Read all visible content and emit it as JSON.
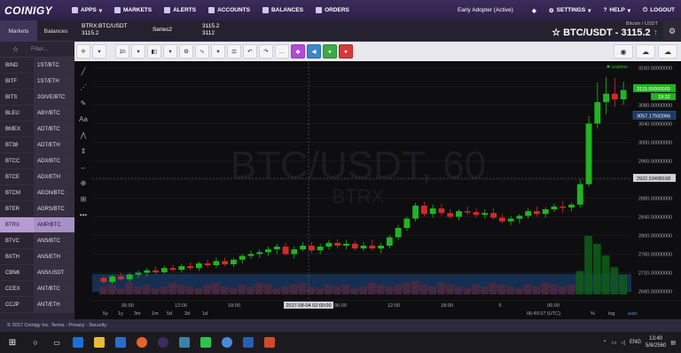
{
  "nav": {
    "logo": "COINIGY",
    "items": [
      "APPS",
      "MARKETS",
      "ALERTS",
      "ACCOUNTS",
      "BALANCES",
      "ORDERS"
    ],
    "status": "Early Adopter (Active)",
    "right_items": [
      "SETTINGS",
      "HELP",
      "LOGOUT"
    ]
  },
  "subheader": {
    "tabs": [
      "Markets",
      "Balances"
    ],
    "market1_name": "BTRX:BTC/USDT",
    "market1_price": "3115.2",
    "market2_name": "Series2",
    "market2_p1": "3115.2",
    "market2_p2": "3112",
    "pair_sub": "Bitcoin / USDT",
    "pair_title": "BTC/USDT - 3115.2"
  },
  "sidebar": {
    "filter_placeholder": "Filter...",
    "rows": [
      {
        "exch": "BIND",
        "pair": "1ST/BTC"
      },
      {
        "exch": "BITF",
        "pair": "1ST/ETH"
      },
      {
        "exch": "BITS",
        "pair": "2GIVE/BTC"
      },
      {
        "exch": "BLEU",
        "pair": "ABY/BTC"
      },
      {
        "exch": "BMEX",
        "pair": "ADT/BTC"
      },
      {
        "exch": "BT38",
        "pair": "ADT/ETH"
      },
      {
        "exch": "BTCC",
        "pair": "ADX/BTC"
      },
      {
        "exch": "BTCE",
        "pair": "ADX/ETH"
      },
      {
        "exch": "BTCM",
        "pair": "AEON/BTC"
      },
      {
        "exch": "BTER",
        "pair": "AGRS/BTC"
      },
      {
        "exch": "BTRX",
        "pair": "AMP/BTC"
      },
      {
        "exch": "BTVC",
        "pair": "ANS/BTC"
      },
      {
        "exch": "BXTH",
        "pair": "ANS/ETH"
      },
      {
        "exch": "CBNK",
        "pair": "ANS/USDT"
      },
      {
        "exch": "CCEX",
        "pair": "ANT/BTC"
      },
      {
        "exch": "CCJP",
        "pair": "ANT/ETH"
      }
    ]
  },
  "toolbar": {
    "interval": "1h"
  },
  "chart": {
    "watermark_main": "BTC/USDT, 60",
    "watermark_sub": "BTRX",
    "realtime": "realtime",
    "price_labels": [
      "3160.00000000",
      "3120.00000000",
      "3080.00000000",
      "3040.00000000",
      "3000.00000000",
      "2960.00000000",
      "2920.00000000",
      "2880.00000000",
      "2840.00000000",
      "2800.00000000",
      "2760.00000000",
      "2720.00000000",
      "2680.00000000"
    ],
    "last_price_tag": "3115.00000000",
    "last_time_tag": "19:32",
    "level_tag": "3057.17932066",
    "cursor_price_tag": "2922.53498168",
    "time_labels": [
      "06:00",
      "12:00",
      "18:00",
      "06:00",
      "12:00",
      "18:00",
      "5",
      "06:00"
    ],
    "cursor_time_tag": "2017-08-04 02:00:00",
    "ranges": [
      "5y",
      "1y",
      "3m",
      "1m",
      "5d",
      "3d",
      "1d"
    ],
    "clock": "06:40:37 (UTC)",
    "scale_opts": [
      "%",
      "log",
      "auto"
    ]
  },
  "footer": {
    "text": "© 2017 Coinigy Inc.  Terms - Privacy - Security"
  },
  "taskbar": {
    "lang": "ENG",
    "time": "13:40",
    "date": "5/8/2560"
  },
  "colors": {
    "up": "#22b422",
    "down": "#d62828",
    "accent": "#b59cd2",
    "nav": "#3b2c5c"
  },
  "chart_data": {
    "type": "candlestick",
    "series": [
      {
        "name": "BTRX:BTC/USDT",
        "candles": [
          [
            2709,
            2712,
            2698,
            2700
          ],
          [
            2700,
            2716,
            2696,
            2712
          ],
          [
            2712,
            2720,
            2704,
            2706
          ],
          [
            2706,
            2720,
            2700,
            2716
          ],
          [
            2716,
            2725,
            2709,
            2720
          ],
          [
            2720,
            2730,
            2712,
            2725
          ],
          [
            2725,
            2733,
            2716,
            2721
          ],
          [
            2721,
            2735,
            2717,
            2730
          ],
          [
            2730,
            2737,
            2722,
            2726
          ],
          [
            2726,
            2740,
            2720,
            2734
          ],
          [
            2734,
            2742,
            2726,
            2730
          ],
          [
            2730,
            2744,
            2724,
            2740
          ],
          [
            2740,
            2748,
            2732,
            2736
          ],
          [
            2736,
            2752,
            2730,
            2745
          ],
          [
            2745,
            2752,
            2734,
            2738
          ],
          [
            2738,
            2752,
            2732,
            2748
          ],
          [
            2748,
            2760,
            2740,
            2756
          ],
          [
            2756,
            2768,
            2750,
            2760
          ],
          [
            2760,
            2770,
            2752,
            2764
          ],
          [
            2764,
            2776,
            2756,
            2770
          ],
          [
            2770,
            2782,
            2760,
            2776
          ],
          [
            2776,
            2784,
            2756,
            2760
          ],
          [
            2760,
            2776,
            2750,
            2770
          ],
          [
            2770,
            2786,
            2766,
            2778
          ],
          [
            2778,
            2786,
            2762,
            2768
          ],
          [
            2768,
            2782,
            2760,
            2776
          ],
          [
            2776,
            2790,
            2770,
            2784
          ],
          [
            2784,
            2792,
            2772,
            2778
          ],
          [
            2778,
            2790,
            2770,
            2782
          ],
          [
            2782,
            2788,
            2768,
            2772
          ],
          [
            2772,
            2786,
            2766,
            2778
          ],
          [
            2778,
            2790,
            2768,
            2772
          ],
          [
            2772,
            2784,
            2762,
            2778
          ],
          [
            2778,
            2800,
            2772,
            2796
          ],
          [
            2796,
            2822,
            2790,
            2816
          ],
          [
            2816,
            2840,
            2810,
            2836
          ],
          [
            2836,
            2870,
            2830,
            2864
          ],
          [
            2864,
            2872,
            2840,
            2846
          ],
          [
            2846,
            2866,
            2838,
            2858
          ],
          [
            2858,
            2868,
            2842,
            2848
          ],
          [
            2848,
            2856,
            2836,
            2840
          ],
          [
            2840,
            2856,
            2832,
            2852
          ],
          [
            2852,
            2862,
            2844,
            2850
          ],
          [
            2850,
            2858,
            2838,
            2844
          ],
          [
            2844,
            2856,
            2836,
            2848
          ],
          [
            2848,
            2858,
            2834,
            2838
          ],
          [
            2838,
            2846,
            2826,
            2830
          ],
          [
            2830,
            2842,
            2822,
            2836
          ],
          [
            2836,
            2846,
            2826,
            2842
          ],
          [
            2842,
            2858,
            2836,
            2852
          ],
          [
            2852,
            2862,
            2840,
            2846
          ],
          [
            2846,
            2860,
            2838,
            2856
          ],
          [
            2856,
            2868,
            2850,
            2862
          ],
          [
            2862,
            2874,
            2848,
            2860
          ],
          [
            2860,
            2870,
            2852,
            2866
          ],
          [
            2866,
            2920,
            2860,
            2910
          ],
          [
            2910,
            3056,
            2904,
            3040
          ],
          [
            3040,
            3128,
            3030,
            3086
          ],
          [
            3086,
            3140,
            3060,
            3104
          ],
          [
            3104,
            3138,
            3076,
            3092
          ],
          [
            3092,
            3130,
            3080,
            3112
          ]
        ]
      }
    ],
    "x_labels": [
      "06:00",
      "12:00",
      "18:00",
      "06:00",
      "12:00",
      "18:00",
      "5",
      "06:00"
    ],
    "ylim": [
      2660,
      3170
    ]
  }
}
